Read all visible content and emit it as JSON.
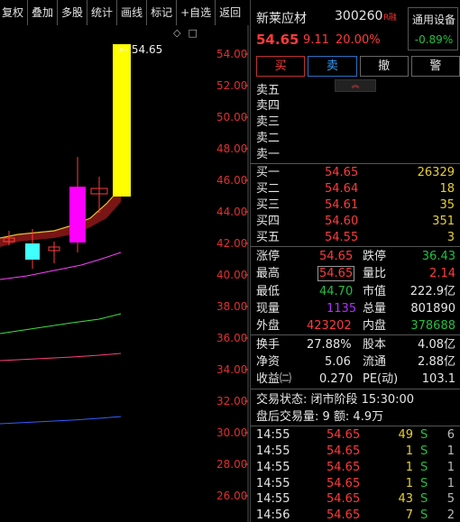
{
  "toolbar": {
    "items": [
      "复权",
      "叠加",
      "多股",
      "统计",
      "画线",
      "标记",
      "+自选",
      "返回"
    ]
  },
  "chart": {
    "price_callout": "← 54.65",
    "mini_icons": [
      "◇",
      "□"
    ],
    "y_ticks": [
      "54.00",
      "52.00",
      "50.00",
      "48.00",
      "46.00",
      "44.00",
      "42.00",
      "40.00",
      "38.00",
      "36.00",
      "34.00",
      "32.00",
      "30.00",
      "28.00",
      "26.00"
    ],
    "colors": {
      "up_bar": "#ffff00",
      "magenta_bar": "#ff00ff",
      "cyan_bar": "#40ffff",
      "band_fill": "#7a1515",
      "ma_yellow": "#e8c030",
      "ma_magenta": "#ff40ff",
      "ma_green": "#40e040",
      "ma_pink": "#ff4080",
      "ma_blue": "#3060ff"
    }
  },
  "header": {
    "name": "新莱应材",
    "code": "300260",
    "tag": "R融",
    "price": "54.65",
    "change": "9.11",
    "pct": "20.00%",
    "box_title": "通用设备",
    "box_pct": "-0.89%"
  },
  "buttons": {
    "buy": "买",
    "sell": "卖",
    "cancel": "撤",
    "alert": "警"
  },
  "orderbook": {
    "toggle_icon": "︽",
    "asks": [
      {
        "label": "卖五",
        "price": "",
        "vol": ""
      },
      {
        "label": "卖四",
        "price": "",
        "vol": ""
      },
      {
        "label": "卖三",
        "price": "",
        "vol": ""
      },
      {
        "label": "卖二",
        "price": "",
        "vol": ""
      },
      {
        "label": "卖一",
        "price": "",
        "vol": ""
      }
    ],
    "bids": [
      {
        "label": "买一",
        "price": "54.65",
        "vol": "26329"
      },
      {
        "label": "买二",
        "price": "54.64",
        "vol": "18"
      },
      {
        "label": "买三",
        "price": "54.61",
        "vol": "35"
      },
      {
        "label": "买四",
        "price": "54.60",
        "vol": "351"
      },
      {
        "label": "买五",
        "price": "54.55",
        "vol": "3"
      }
    ]
  },
  "stats": {
    "limit_up_k": "涨停",
    "limit_up_v": "54.65",
    "limit_down_k": "跌停",
    "limit_down_v": "36.43",
    "high_k": "最高",
    "high_v": "54.65",
    "ratio_k": "量比",
    "ratio_v": "2.14",
    "low_k": "最低",
    "low_v": "44.70",
    "mktcap_k": "市值",
    "mktcap_v": "222.9亿",
    "cur_k": "现量",
    "cur_v": "1135",
    "total_k": "总量",
    "total_v": "801890",
    "outer_k": "外盘",
    "outer_v": "423202",
    "inner_k": "内盘",
    "inner_v": "378688",
    "turnover_k": "换手",
    "turnover_v": "27.88%",
    "equity_k": "股本",
    "equity_v": "4.08亿",
    "nav_k": "净资",
    "nav_v": "5.06",
    "float_k": "流通",
    "float_v": "2.88亿",
    "eps_k": "收益㈡",
    "eps_v": "0.270",
    "pe_k": "PE(动)",
    "pe_v": "103.1"
  },
  "trading": {
    "status": "交易状态: 闭市阶段 15:30:00",
    "after_hours": "盘后交易量: 9  额: 4.9万"
  },
  "ticks": [
    {
      "time": "14:55",
      "price": "54.65",
      "vol": "49",
      "side": "S",
      "n": "6"
    },
    {
      "time": "14:55",
      "price": "54.65",
      "vol": "1",
      "side": "S",
      "n": "1"
    },
    {
      "time": "14:55",
      "price": "54.65",
      "vol": "1",
      "side": "S",
      "n": "1"
    },
    {
      "time": "14:55",
      "price": "54.65",
      "vol": "1",
      "side": "S",
      "n": "1"
    },
    {
      "time": "14:55",
      "price": "54.65",
      "vol": "43",
      "side": "S",
      "n": "5"
    },
    {
      "time": "14:56",
      "price": "54.65",
      "vol": "7",
      "side": "S",
      "n": "2"
    }
  ]
}
